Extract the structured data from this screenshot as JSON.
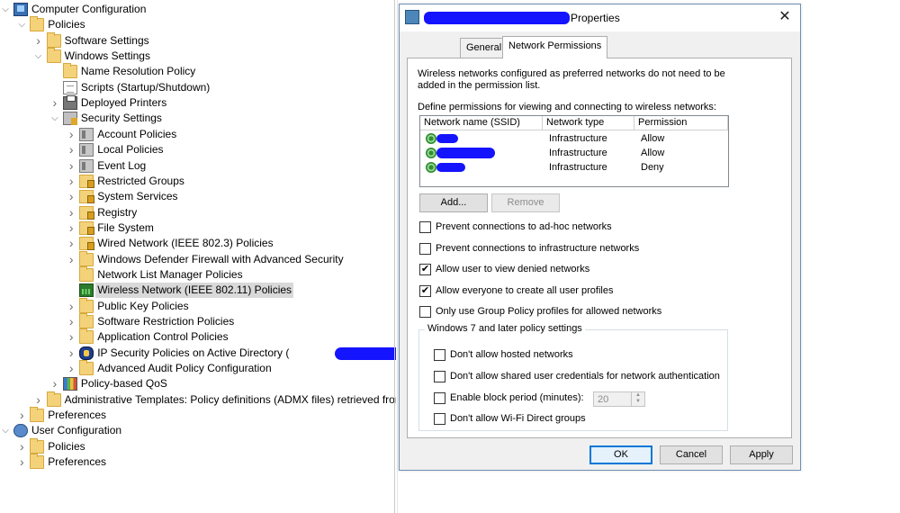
{
  "tree": {
    "items": [
      {
        "label": "Computer Configuration",
        "icon": "computer-icon",
        "expanded": true,
        "level": 0
      },
      {
        "label": "Policies",
        "icon": "folder-icon",
        "expanded": true,
        "level": 1
      },
      {
        "label": "Software Settings",
        "icon": "folder-icon",
        "expanded": false,
        "level": 2
      },
      {
        "label": "Windows Settings",
        "icon": "folder-icon",
        "expanded": true,
        "level": 2
      },
      {
        "label": "Name Resolution Policy",
        "icon": "folder-icon",
        "level": 3
      },
      {
        "label": "Scripts (Startup/Shutdown)",
        "icon": "script-icon",
        "level": 3
      },
      {
        "label": "Deployed Printers",
        "icon": "printer-icon",
        "expanded": false,
        "level": 3
      },
      {
        "label": "Security Settings",
        "icon": "security-icon",
        "expanded": true,
        "level": 3
      },
      {
        "label": "Account Policies",
        "icon": "policy-book-icon",
        "expanded": false,
        "level": 4
      },
      {
        "label": "Local Policies",
        "icon": "policy-book-icon",
        "expanded": false,
        "level": 4
      },
      {
        "label": "Event Log",
        "icon": "event-log-icon",
        "expanded": false,
        "level": 4
      },
      {
        "label": "Restricted Groups",
        "icon": "locked-folder-icon",
        "expanded": false,
        "level": 4
      },
      {
        "label": "System Services",
        "icon": "locked-folder-icon",
        "expanded": false,
        "level": 4
      },
      {
        "label": "Registry",
        "icon": "locked-folder-icon",
        "expanded": false,
        "level": 4
      },
      {
        "label": "File System",
        "icon": "locked-folder-icon",
        "expanded": false,
        "level": 4
      },
      {
        "label": "Wired Network (IEEE 802.3) Policies",
        "icon": "wired-network-icon",
        "expanded": false,
        "level": 4
      },
      {
        "label": "Windows Defender Firewall with Advanced Security",
        "icon": "folder-icon",
        "expanded": false,
        "level": 4
      },
      {
        "label": "Network List Manager Policies",
        "icon": "folder-icon",
        "level": 4
      },
      {
        "label": "Wireless Network (IEEE 802.11) Policies",
        "icon": "wireless-network-icon",
        "level": 4,
        "selected": true
      },
      {
        "label": "Public Key Policies",
        "icon": "folder-icon",
        "expanded": false,
        "level": 4
      },
      {
        "label": "Software Restriction Policies",
        "icon": "folder-icon",
        "expanded": false,
        "level": 4
      },
      {
        "label": "Application Control Policies",
        "icon": "folder-icon",
        "expanded": false,
        "level": 4
      },
      {
        "label": "IP Security Policies on Active Directory (",
        "icon": "ip-security-icon",
        "expanded": false,
        "level": 4,
        "redacted": true
      },
      {
        "label": "Advanced Audit Policy Configuration",
        "icon": "folder-icon",
        "expanded": false,
        "level": 4
      },
      {
        "label": "Policy-based QoS",
        "icon": "qos-chart-icon",
        "expanded": false,
        "level": 3
      },
      {
        "label": "Administrative Templates: Policy definitions (ADMX files) retrieved from",
        "icon": "folder-icon",
        "expanded": false,
        "level": 2
      },
      {
        "label": "Preferences",
        "icon": "folder-icon",
        "expanded": false,
        "level": 1
      },
      {
        "label": "User Configuration",
        "icon": "user-icon",
        "expanded": true,
        "level": 0
      },
      {
        "label": "Policies",
        "icon": "folder-icon",
        "expanded": false,
        "level": 1
      },
      {
        "label": "Preferences",
        "icon": "folder-icon",
        "expanded": false,
        "level": 1
      }
    ]
  },
  "dialog": {
    "title": "Properties",
    "close_glyph": "✕",
    "tabs": [
      {
        "label": "General",
        "active": false
      },
      {
        "label": "Network Permissions",
        "active": true
      }
    ],
    "intro_text_line1": "Wireless networks configured as preferred networks do not need to be",
    "intro_text_line2": "added in the permission list.",
    "define_text": "Define permissions for viewing and connecting to wireless networks:",
    "columns": [
      "Network name (SSID)",
      "Network type",
      "Permission"
    ],
    "networks": [
      {
        "ssid": "",
        "type": "Infrastructure",
        "permission": "Allow"
      },
      {
        "ssid": "",
        "type": "Infrastructure",
        "permission": "Allow"
      },
      {
        "ssid": "",
        "type": "Infrastructure",
        "permission": "Deny"
      }
    ],
    "add_label": "Add...",
    "remove_label": "Remove",
    "options": [
      {
        "label": "Prevent connections to ad-hoc networks",
        "checked": false
      },
      {
        "label": "Prevent connections to infrastructure networks",
        "checked": false
      },
      {
        "label": "Allow user to view denied networks",
        "checked": true
      },
      {
        "label": "Allow everyone to create all user profiles",
        "checked": true
      },
      {
        "label": "Only use Group Policy profiles for allowed networks",
        "checked": false
      }
    ],
    "group_title": "Windows 7 and later policy settings",
    "group_options": [
      {
        "label": "Don't allow hosted networks",
        "checked": false
      },
      {
        "label": "Don't allow shared user credentials for network authentication",
        "checked": false
      },
      {
        "label": "Enable block period (minutes):",
        "checked": false
      },
      {
        "label": "Don't allow Wi-Fi Direct groups",
        "checked": false
      }
    ],
    "block_period_value": "20",
    "ok_label": "OK",
    "cancel_label": "Cancel",
    "apply_label": "Apply"
  },
  "colors": {
    "redaction": "#1414ff",
    "selection": "#d9d9d9",
    "accent": "#0078d7"
  }
}
